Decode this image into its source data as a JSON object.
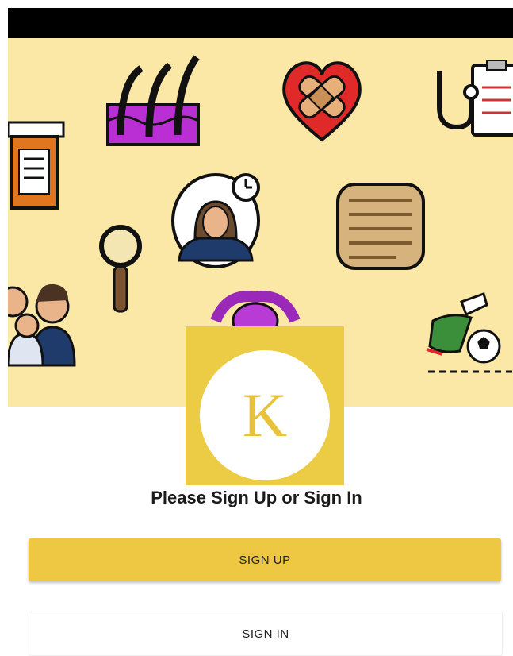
{
  "hero": {
    "icons": [
      "hair-follicle-icon",
      "heart-bandage-icon",
      "stethoscope-clipboard-icon",
      "pill-bottle-icon",
      "sleeping-woman-clock-icon",
      "intestines-icon",
      "magnifier-icon",
      "family-icon",
      "uterus-icon",
      "soccer-injury-icon"
    ]
  },
  "logo": {
    "letter": "K"
  },
  "prompt": "Please Sign Up or Sign In",
  "buttons": {
    "sign_up": "SIGN UP",
    "sign_in": "SIGN IN"
  },
  "colors": {
    "accent": "#eec743",
    "hero_bg": "#fbe8a6"
  }
}
